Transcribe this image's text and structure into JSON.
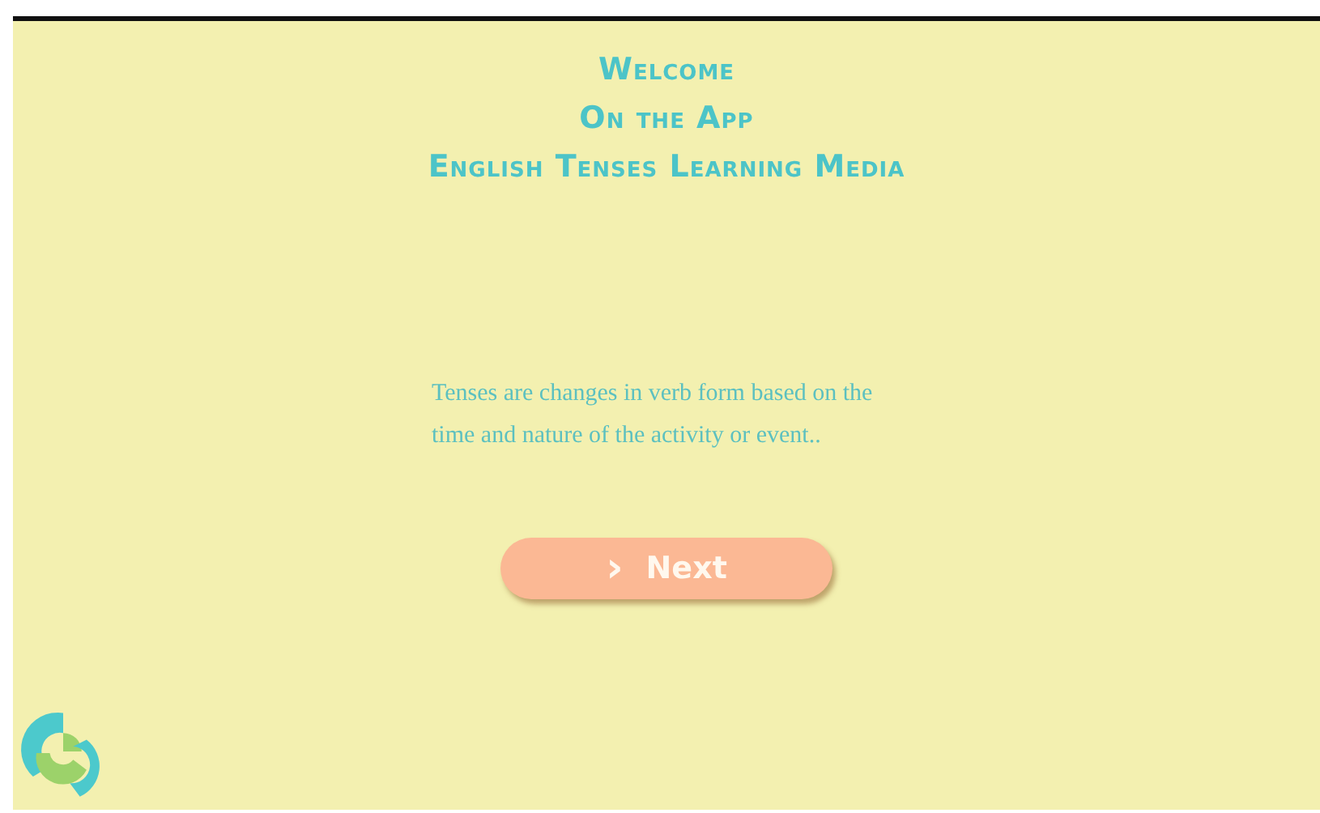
{
  "heading": [
    "Welcome",
    "On the App",
    "English Tenses Learning Media"
  ],
  "description": "Tenses are changes in verb form based on the time and nature of the activity or event..",
  "next_button": {
    "icon": "›",
    "label": "Next"
  }
}
